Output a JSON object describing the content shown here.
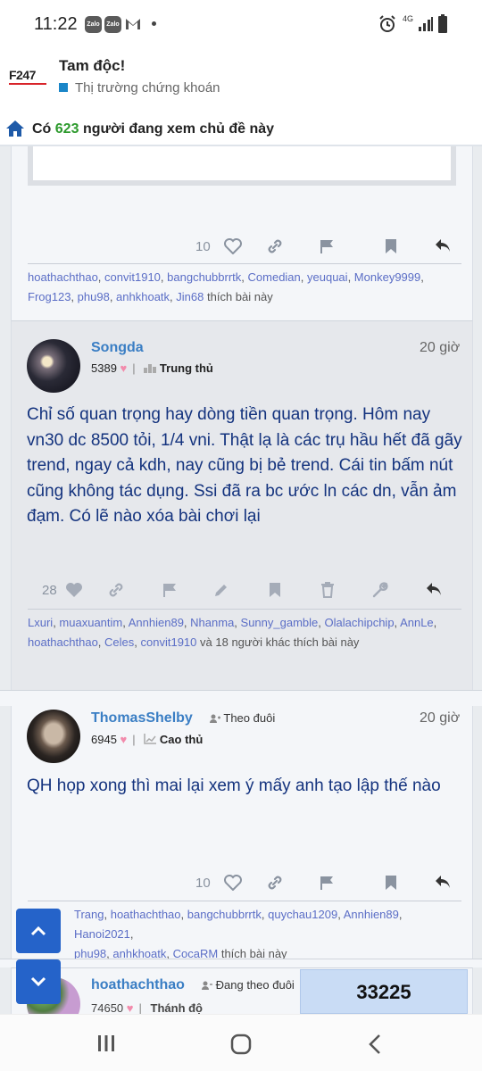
{
  "status_bar": {
    "time": "11:22",
    "notif_zalo_1": "Zalo",
    "notif_zalo_2": "Zalo",
    "network": "4G"
  },
  "header": {
    "logo_text": "F247",
    "title": "Tam độc!",
    "subtitle": "Thị trường chứng khoán"
  },
  "viewers": {
    "prefix": "Có",
    "count": "623",
    "suffix": "người đang xem chủ đề này"
  },
  "post_prev": {
    "like_count": "10",
    "likes_line1": [
      "hoathachthao",
      "convit1910",
      "bangchubbrrtk",
      "Comedian",
      "yeuquai",
      "Monkey9999"
    ],
    "likes_line2": [
      "Frog123",
      "phu98",
      "anhkhoatk",
      "Jin68"
    ],
    "likes_suffix": "thích bài này"
  },
  "post_songda": {
    "username": "Songda",
    "time": "20 giờ",
    "points": "5389",
    "rank": "Trung thủ",
    "body": "Chỉ số quan trọng hay dòng tiền quan trọng. Hôm nay vn30 dc 8500 tỏi, 1/4 vni. Thật lạ là các trụ hầu hết đã gãy trend, ngay cả kdh, nay cũng bị bẻ trend. Cái tin bấm nút cũng không tác dụng. Ssi đã ra bc ước ln các dn, vẫn ảm đạm. Có lẽ nào xóa bài chơi lại",
    "like_count": "28",
    "likes_line1": [
      "Lxuri",
      "muaxuantim",
      "Annhien89",
      "Nhanma",
      "Sunny_gamble",
      "Olalachipchip",
      "AnnLe"
    ],
    "likes_line2": [
      "hoathachthao",
      "Celes",
      "convit1910"
    ],
    "likes_suffix": "và 18 người khác thích bài này"
  },
  "post_thomas": {
    "username": "ThomasShelby",
    "follow": "Theo đuôi",
    "time": "20 giờ",
    "points": "6945",
    "rank": "Cao thủ",
    "body": "QH họp xong thì mai lại xem ý mấy anh tạo lập thế nào",
    "like_count": "10",
    "likes_line1_visible": [
      "Trang",
      "hoathachthao",
      "bangchubbrrtk",
      "quychau1209",
      "Annhien89",
      "Hanoi2021"
    ],
    "likes_line2_visible": [
      "phu98",
      "anhkhoatk",
      "CocaRM"
    ],
    "likes_suffix": "thích bài này"
  },
  "post_next": {
    "username": "hoathachthao",
    "follow": "Đang theo đuôi",
    "points_partial": "74650",
    "rank_partial": "Thánh độ"
  },
  "counter": "33225",
  "colors": {
    "link_blue": "#3a7ec4",
    "body_blue": "#14337e",
    "count_green": "#2d9a2d",
    "fab_blue": "#2563c9",
    "user_link": "#5b6ec6"
  }
}
